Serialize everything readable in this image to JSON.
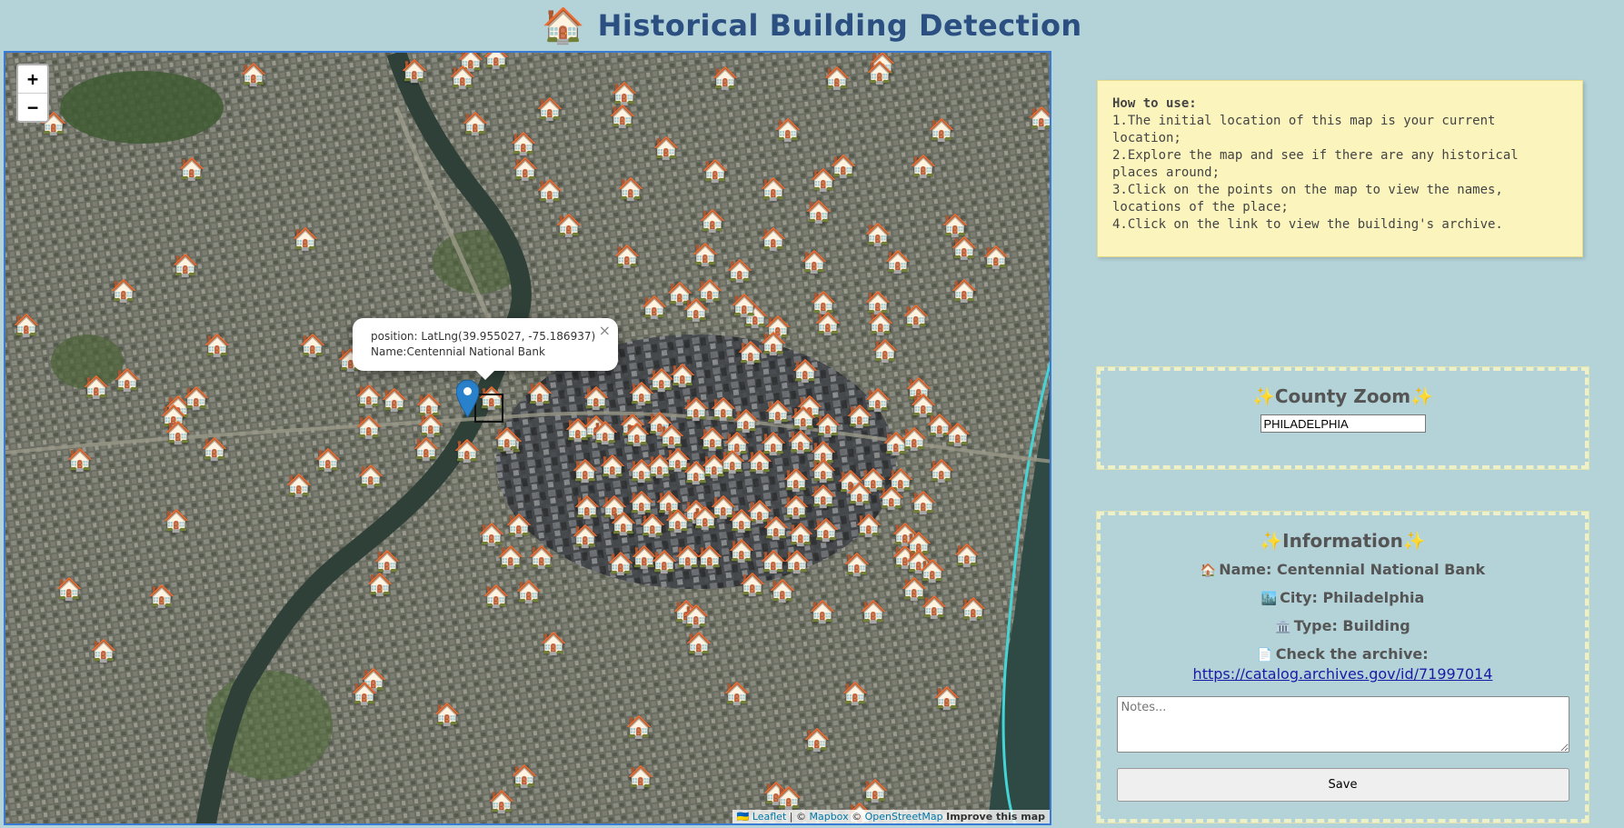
{
  "header": {
    "icon": "🏠",
    "title": "Historical Building Detection"
  },
  "map": {
    "zoom_in_label": "+",
    "zoom_out_label": "−",
    "popup": {
      "position_text": "position: LatLng(39.955027, -75.186937)",
      "name_text": "Name:Centennial National Bank",
      "close_label": "×"
    },
    "attribution": {
      "leaflet": "Leaflet",
      "separator": "|",
      "mapbox_prefix": "©",
      "mapbox": "Mapbox",
      "osm_prefix": "©",
      "osm": "OpenStreetMap",
      "improve": "Improve this map"
    },
    "marker_icon": "house-icon",
    "marker_glyph": "🏠",
    "colors": {
      "pin": "#2a81cb",
      "border": "#3a7bd5"
    }
  },
  "howto": {
    "title": "How to use:",
    "steps": [
      "1.The initial location of this map is your current location;",
      "2.Explore the map and see if there are any historical places around;",
      "3.Click on the points on the map to view the names, locations of the place;",
      "4.Click on the link to view the building's archive."
    ]
  },
  "county": {
    "title": "✨County Zoom✨",
    "input_value": "PHILADELPHIA"
  },
  "info": {
    "title": "✨Information✨",
    "name_icon": "🏠",
    "name": "Name: Centennial National Bank",
    "city_icon": "🏙️",
    "city": "City: Philadelphia",
    "type_icon": "🏛️",
    "type": "Type: Building",
    "archive_icon": "📄",
    "archive_label": "Check the archive:",
    "archive_link": "https://catalog.archives.gov/id/71997014",
    "notes_placeholder": "Notes...",
    "save_label": "Save"
  }
}
